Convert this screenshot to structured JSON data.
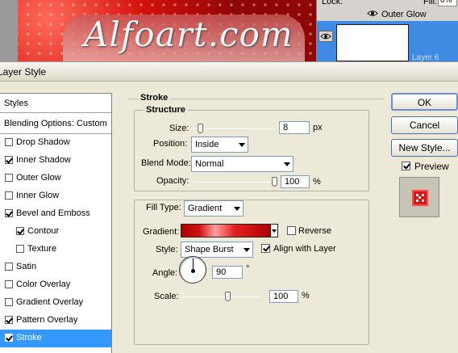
{
  "background": {
    "watermark": "Alfoart.com"
  },
  "layers_panel": {
    "lock_label": "Lock:",
    "fill_label": "Fill:",
    "fill_value": "0%",
    "effect_label": "Outer Glow",
    "layer_name": "Layer 6"
  },
  "dialog": {
    "title": "Layer Style"
  },
  "styles_list": {
    "header": "Styles",
    "blending": "Blending Options: Custom",
    "items": [
      {
        "label": "Drop Shadow",
        "checked": false
      },
      {
        "label": "Inner Shadow",
        "checked": true
      },
      {
        "label": "Outer Glow",
        "checked": false
      },
      {
        "label": "Inner Glow",
        "checked": false
      },
      {
        "label": "Bevel and Emboss",
        "checked": true
      },
      {
        "label": "Contour",
        "checked": true
      },
      {
        "label": "Texture",
        "checked": false
      },
      {
        "label": "Satin",
        "checked": false
      },
      {
        "label": "Color Overlay",
        "checked": false
      },
      {
        "label": "Gradient Overlay",
        "checked": false
      },
      {
        "label": "Pattern Overlay",
        "checked": true
      },
      {
        "label": "Stroke",
        "checked": true
      }
    ],
    "selected": "Stroke"
  },
  "stroke": {
    "title": "Stroke",
    "structure": {
      "title": "Structure",
      "size_label": "Size:",
      "size_value": "8",
      "size_unit": "px",
      "size_fraction": 0.05,
      "position_label": "Position:",
      "position_value": "Inside",
      "blend_label": "Blend Mode:",
      "blend_value": "Normal",
      "opacity_label": "Opacity:",
      "opacity_value": "100",
      "opacity_unit": "%",
      "opacity_fraction": 1.0
    },
    "fill": {
      "fill_type_label": "Fill Type:",
      "fill_type_value": "Gradient",
      "gradient_label": "Gradient:",
      "reverse_label": "Reverse",
      "reverse_checked": false,
      "style_label": "Style:",
      "style_value": "Shape Burst",
      "align_label": "Align with Layer",
      "align_checked": true,
      "angle_label": "Angle:",
      "angle_value": "90",
      "angle_unit": "°",
      "scale_label": "Scale:",
      "scale_value": "100",
      "scale_unit": "%",
      "scale_fraction": 0.6
    }
  },
  "buttons": {
    "ok": "OK",
    "cancel": "Cancel",
    "new_style": "New Style...",
    "preview_label": "Preview",
    "preview_checked": true
  },
  "colors": {
    "selection": "#3399ff",
    "stroke_gradient_dark": "#b00000",
    "stroke_gradient_light": "#ff9e9e"
  }
}
